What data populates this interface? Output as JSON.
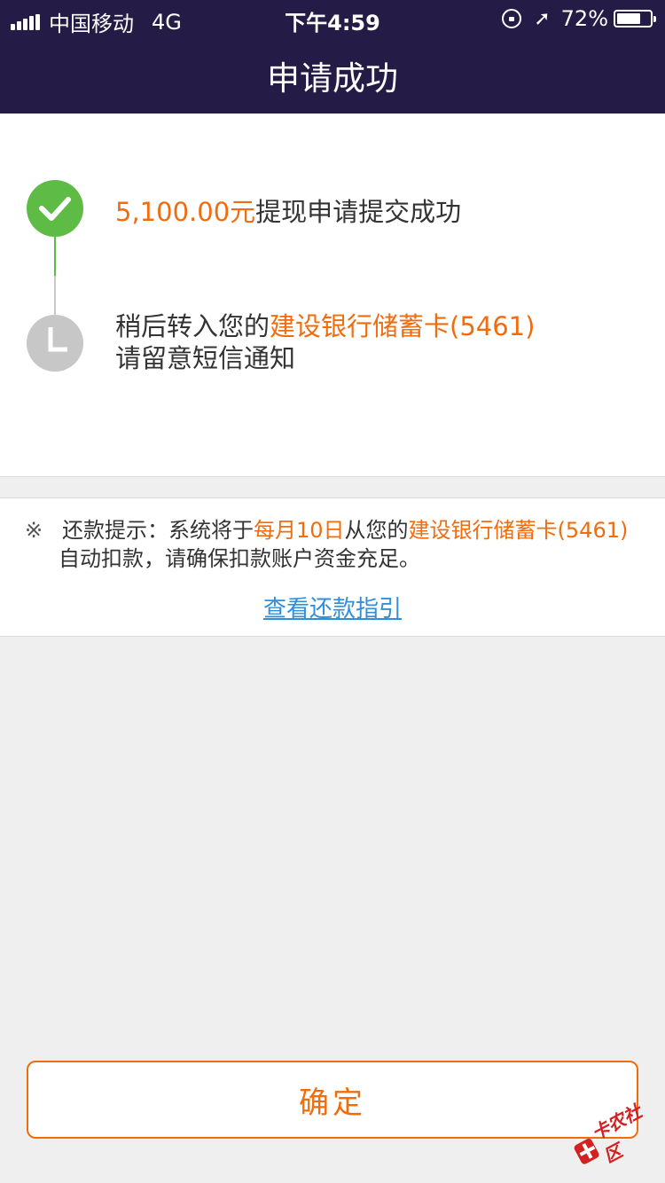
{
  "status_bar": {
    "carrier": "中国移动",
    "network": "4G",
    "time": "下午4:59",
    "battery_text": "72%",
    "battery_level": 0.72
  },
  "nav": {
    "title": "申请成功"
  },
  "steps": {
    "step1_amount": "5,100.00元",
    "step1_text": "提现申请提交成功",
    "step2_prefix": "稍后转入您的",
    "step2_card": "建设银行储蓄卡(5461)",
    "step2_line2": "请留意短信通知"
  },
  "tip": {
    "mark": "※",
    "prefix": "还款提示：系统将于",
    "date": "每月10日",
    "middle": "从您的",
    "card": "建设银行储蓄卡(5461)",
    "suffix": "自动扣款，请确保扣款账户资金充足。",
    "link": "查看还款指引"
  },
  "confirm_button": "确定",
  "watermark": "卡农社区",
  "colors": {
    "header_bg": "#241c46",
    "accent": "#ef6d0f",
    "success": "#5dbb46",
    "pending": "#c7c7c7",
    "link": "#2f8fdc"
  }
}
